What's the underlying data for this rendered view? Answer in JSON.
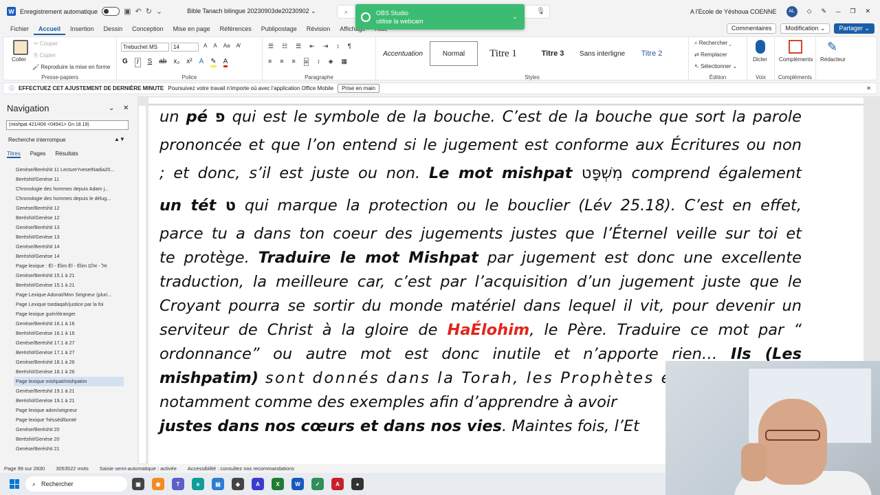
{
  "titlebar": {
    "autosave": "Enregistrement automatique",
    "doc_title": "Bible Tanach bilingue 20230903de20230902 ⌄",
    "search_placeholder": "",
    "user": "A l'Ecole de Yéshoua COENNE",
    "avatar": "AL"
  },
  "obs": {
    "title": "OBS Studio",
    "message": "utilise la webcam"
  },
  "menu": {
    "tabs": [
      "Fichier",
      "Accueil",
      "Insertion",
      "Dessin",
      "Conception",
      "Mise en page",
      "Références",
      "Publipostage",
      "Révision",
      "Affichage",
      "Aide"
    ],
    "comments": "Commentaires",
    "modification": "Modification ⌄",
    "share": "Partager ⌄"
  },
  "ribbon": {
    "clipboard": {
      "paste": "Coller",
      "cut": "Couper",
      "copy": "Copier",
      "format": "Reproduire la mise en forme",
      "label": "Presse-papiers"
    },
    "font": {
      "family": "Trebuchet MS",
      "size": "14",
      "label": "Police"
    },
    "paragraph": {
      "label": "Paragraphe"
    },
    "styles": {
      "items": [
        "Accentuation",
        "Normal",
        "Titre 1",
        "Titre 3",
        "Sans interligne",
        "Titre 2"
      ],
      "label": "Styles"
    },
    "edit": {
      "find": "Rechercher ⌄",
      "replace": "Remplacer",
      "select": "Sélectionner ⌄",
      "label": "Édition"
    },
    "voice": {
      "dictate": "Dicter",
      "label": "Voix"
    },
    "addins": {
      "addins": "Compléments",
      "label": "Compléments"
    },
    "editor": {
      "label": "Rédacteur"
    }
  },
  "infobar": {
    "title": "EFFECTUEZ CET AJUSTEMENT DE DERNIÈRE MINUTE",
    "text": "Poursuivez votre travail n'importe où avec l'application Office Mobile",
    "button": "Prise en main"
  },
  "navigation": {
    "title": "Navigation",
    "search": "(mishpat 421/406 <04941> Gn 18.19)",
    "interrupted": "Recherche interrompue",
    "tabs": [
      "Titres",
      "Pages",
      "Résultats"
    ],
    "items": [
      "Genèse/Beréshit 11 LectureYvesetNadia20...",
      "Beréshit/Genèse 11",
      "Chronologie des hommes depuis Adam j...",
      "Chronologie des hommes depuis le délug...",
      "Genèse/Beréshit 12",
      "Beréshit/Genèse 12",
      "Genèse/Beréshit 13",
      "Beréshit/Genèse 13",
      "Genèse/Beréshit 14",
      "Beréshit/Genèse 14",
      "Page lexique : Él - Élim Él - Élim אל - אלם",
      "Genèse/Beréshit 15.1 à 21",
      "Beréshit/Genèse 15.1 à 21",
      "Page Lexique Adonaï/Mon Seigneur (pluri...",
      "Page Lexique tsedaqah/justice par la foi",
      "Page lexique guér/étranger",
      "Genèse/Beréshit 16.1 à 16",
      "Beréshit/Genèse 16.1 à 16",
      "Genèse/Beréshit 17.1 à 27",
      "Beréshit/Genèse 17.1 à 27",
      "Genèse/Beréshit 18.1 à 26",
      "Beréshit/Genèse 18.1 à 26",
      "Page lexique mishpat/mishpatim",
      "Genèse/Beréshit 19.1 à 21",
      "Beréshit/Genèse 19.1 à 21",
      "Page lexique adon/seigneur",
      "Page lexique 'hésséd/bonté",
      "Genèse/Beréshit 20",
      "Beréshit/Genèse 20",
      "Genèse/Beréshit 21"
    ],
    "selected_index": 22
  },
  "document": {
    "l1a": "un ",
    "l1b": "pé ",
    "l1c": "פ",
    "l1d": " qui est le symbole de la bouche. C’est de la bouche que sort la parole",
    "l2": "prononcée et que l’on entend si le jugement est conforme aux Écritures ou non",
    "l3a": "; et donc, s’il est juste ou non. ",
    "l3b": "Le mot mishpat ",
    "l3c": "מִשְׁפָּט",
    "l3d": " comprend également",
    "l4a": "un tét ",
    "l4b": "ט",
    "l4c": " qui marque la protection ou le bouclier (Lév 25.18). C’est en effet,",
    "l5": "parce tu a dans ton coeur des jugements justes que l’Éternel veille sur toi et",
    "l6a": "te protège. ",
    "l6b": "Traduire le mot Mishpat",
    "l6c": " par jugement est donc une excellente",
    "l7": "traduction, la meilleure car, c’est par l’acquisition d’un jugement juste que le",
    "l8": "Croyant pourra se sortir du monde matériel dans lequel il vit, pour devenir un",
    "l9a": "serviteur de Christ à la gloire de ",
    "l9b": "HaÉlohim",
    "l9c": ", le Père. Traduire ce mot par “",
    "l10a": "ordonnance” ou autre mot est donc inutile et n’apporte rien… ",
    "l10b": "Ils (Les",
    "l11a": "mishpatim)",
    "l11b": " sont donnés dans la Torah, les Prophètes e",
    "l12": "notamment comme des exemples afin d’apprendre à avoir",
    "l13a": "justes dans nos cœurs et dans nos vies",
    "l13b": ". Maintes fois, l’Et"
  },
  "status": {
    "page": "Page 99 sur 2830",
    "words": "3053522 mots",
    "mode": "Saisie semi-automatique : activée",
    "access": "Accessibilité : consultez nos recommandations"
  },
  "taskbar": {
    "search": "Rechercher"
  }
}
